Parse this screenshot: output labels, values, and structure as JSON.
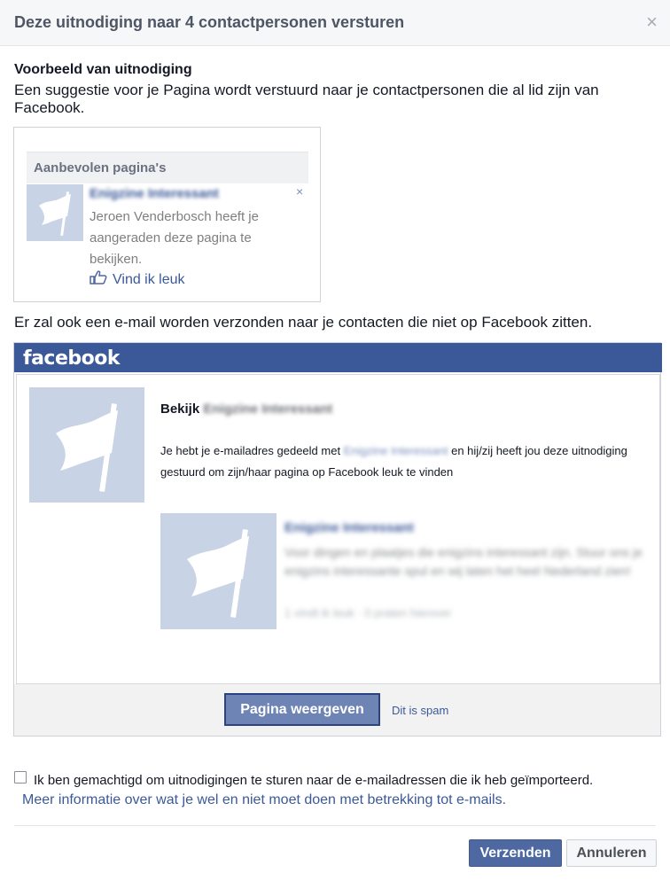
{
  "dialog": {
    "title": "Deze uitnodiging naar 4 contactpersonen versturen",
    "close_label": "×"
  },
  "preview": {
    "heading": "Voorbeeld van uitnodiging",
    "description": "Een suggestie voor je Pagina wordt verstuurd naar je contactpersonen die al lid zijn van Facebook.",
    "card_header": "Aanbevolen pagina's",
    "page_name": "Enigzine Interessant",
    "recommendation_text": "Jeroen Venderbosch heeft je aangeraden deze pagina te bekijken.",
    "like_label": "Vind ik leuk",
    "dismiss_label": "×"
  },
  "email_note": "Er zal ook een e-mail worden verzonden naar je contacten die niet op Facebook zitten.",
  "email": {
    "logo": "facebook",
    "bekijk_label": "Bekijk",
    "page_name": "Enigzine Interessant",
    "body_prefix": "Je hebt je e-mailadres gedeeld met",
    "body_link": "Enigzine Interessant",
    "body_suffix": "en hij/zij heeft jou deze uitnodiging gestuurd om zijn/haar pagina op Facebook leuk te vinden",
    "card_title": "Enigzine Interessant",
    "card_description": "Voor dingen en plaatjes die enigzins interessant zijn. Stuur ons je enigzins interessante spul en wij laten het heel Nederland zien!",
    "card_stats": "1 vindt ik leuk · 0 praten hierover",
    "view_button": "Pagina weergeven",
    "spam_link": "Dit is spam"
  },
  "consent": {
    "checkbox_label": "Ik ben gemachtigd om uitnodigingen te sturen naar de e-mailadressen die ik heb geïmporteerd.",
    "checked": false,
    "more_info_link": "Meer informatie over wat je wel en niet moet doen met betrekking tot e-mails."
  },
  "actions": {
    "send": "Verzenden",
    "cancel": "Annuleren"
  },
  "colors": {
    "facebook_blue": "#3b5998",
    "thumb_bg": "#c8d3e5",
    "primary_button": "#4e69a2"
  },
  "icons": {
    "close": "close-icon",
    "flag": "flag-icon",
    "like": "thumbs-up-icon"
  }
}
